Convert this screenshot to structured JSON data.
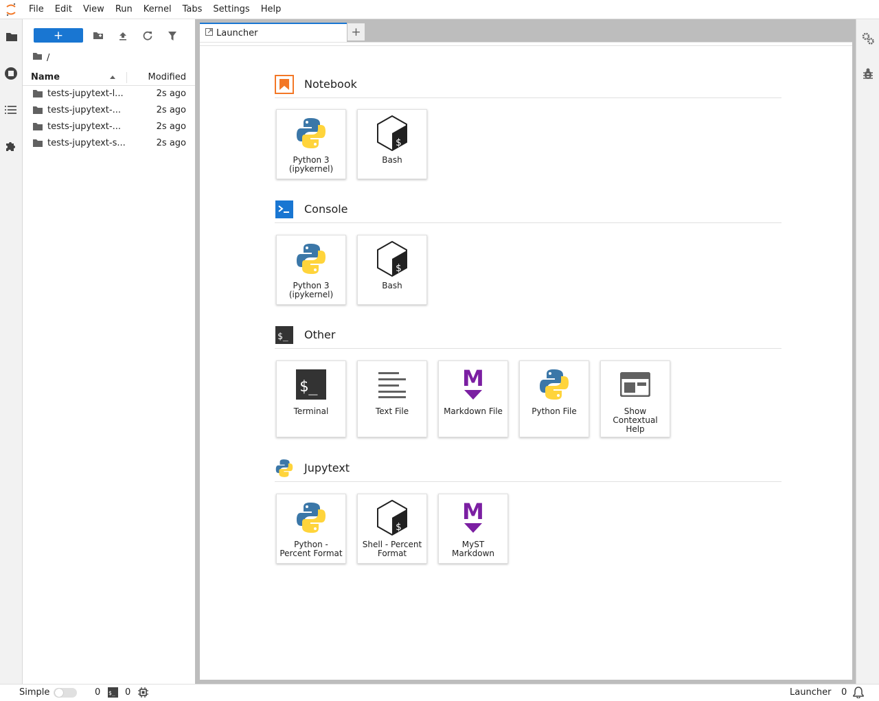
{
  "menubar": {
    "items": [
      "File",
      "Edit",
      "View",
      "Run",
      "Kernel",
      "Tabs",
      "Settings",
      "Help"
    ]
  },
  "left_bar": {
    "icons": [
      "folder-icon",
      "running-icon",
      "toc-icon",
      "extension-icon"
    ]
  },
  "filebrowser": {
    "new_button": "+",
    "breadcrumb": "/",
    "columns": {
      "name": "Name",
      "modified": "Modified"
    },
    "rows": [
      {
        "name": "tests-jupytext-l...",
        "modified": "2s ago"
      },
      {
        "name": "tests-jupytext-...",
        "modified": "2s ago"
      },
      {
        "name": "tests-jupytext-...",
        "modified": "2s ago"
      },
      {
        "name": "tests-jupytext-s...",
        "modified": "2s ago"
      }
    ]
  },
  "tabs": {
    "launcher": "Launcher",
    "add": "+"
  },
  "launcher": {
    "sections": [
      {
        "title": "Notebook",
        "cards": [
          {
            "label": "Python 3 (ipykernel)",
            "icon": "python-icon"
          },
          {
            "label": "Bash",
            "icon": "bash-icon"
          }
        ]
      },
      {
        "title": "Console",
        "cards": [
          {
            "label": "Python 3 (ipykernel)",
            "icon": "python-icon"
          },
          {
            "label": "Bash",
            "icon": "bash-icon"
          }
        ]
      },
      {
        "title": "Other",
        "cards": [
          {
            "label": "Terminal",
            "icon": "terminal-icon"
          },
          {
            "label": "Text File",
            "icon": "text-file-icon"
          },
          {
            "label": "Markdown File",
            "icon": "markdown-icon"
          },
          {
            "label": "Python File",
            "icon": "python-icon"
          },
          {
            "label": "Show Contextual Help",
            "icon": "contextual-help-icon"
          }
        ]
      },
      {
        "title": "Jupytext",
        "cards": [
          {
            "label": "Python - Percent Format",
            "icon": "python-icon"
          },
          {
            "label": "Shell - Percent Format",
            "icon": "bash-icon"
          },
          {
            "label": "MyST Markdown",
            "icon": "markdown-icon"
          }
        ]
      }
    ]
  },
  "statusbar": {
    "mode": "Simple",
    "terminals_count": "0",
    "kernels_count": "0",
    "active_tab": "Launcher",
    "notifications_count": "0"
  },
  "colors": {
    "accent": "#1976d2",
    "notebook_orange": "#f37726",
    "console_blue": "#1976d2",
    "markdown_purple": "#7b1fa2",
    "python_blue": "#3b77a8",
    "python_yellow": "#ffd43b"
  }
}
